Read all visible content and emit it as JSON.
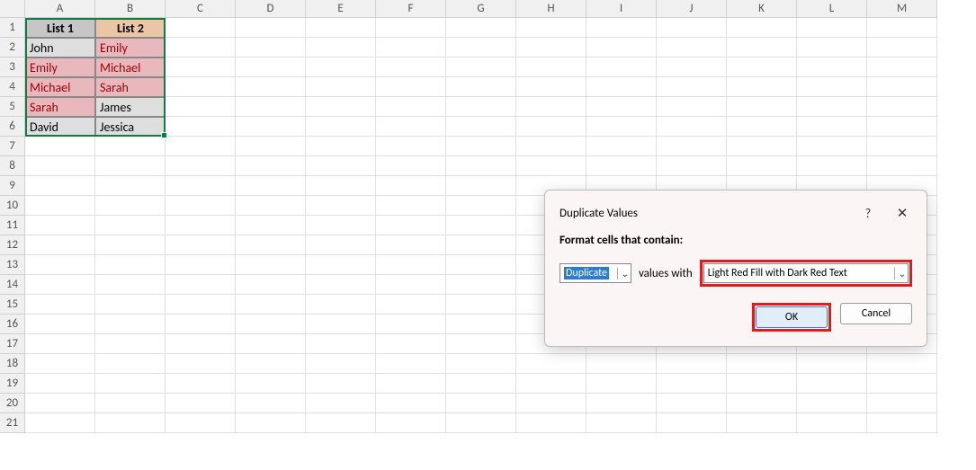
{
  "columns": [
    "A",
    "B",
    "C",
    "D",
    "E",
    "F",
    "G",
    "H",
    "I",
    "J",
    "K",
    "L",
    "M"
  ],
  "rows": [
    "1",
    "2",
    "3",
    "4",
    "5",
    "6",
    "7",
    "8",
    "9",
    "10",
    "11",
    "12",
    "13",
    "14",
    "15",
    "16",
    "17",
    "18",
    "19",
    "20",
    "21"
  ],
  "headers": {
    "a": "List 1",
    "b": "List 2"
  },
  "data": {
    "a": [
      "John",
      "Emily",
      "Michael",
      "Sarah",
      "David"
    ],
    "b": [
      "Emily",
      "Michael",
      "Sarah",
      "James",
      "Jessica"
    ],
    "a_dup": [
      false,
      true,
      true,
      true,
      false
    ],
    "b_dup": [
      true,
      true,
      true,
      false,
      false
    ]
  },
  "dialog": {
    "title": "Duplicate Values",
    "help": "?",
    "close": "✕",
    "label": "Format cells that contain:",
    "condition": "Duplicate",
    "values_with": "values with",
    "format": "Light Red Fill with Dark Red Text",
    "ok": "OK",
    "cancel": "Cancel"
  }
}
